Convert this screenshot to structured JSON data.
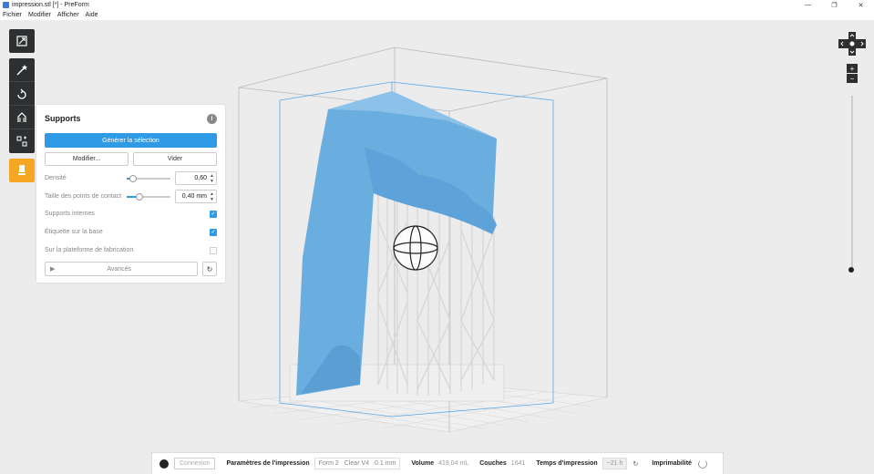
{
  "window": {
    "title": "impression.stl [*] - PreForm",
    "minimize": "—",
    "maximize": "❐",
    "close": "✕"
  },
  "menu": [
    "Fichier",
    "Modifier",
    "Afficher",
    "Aide"
  ],
  "toolbar": {
    "icons": [
      "layout-icon",
      "magic-wand-icon",
      "rotate-icon",
      "supports-icon",
      "layout-tools-icon",
      "print-icon"
    ],
    "active_color": "#f5a623",
    "dark_color": "#2d2f31"
  },
  "supports_panel": {
    "title": "Supports",
    "info": "i",
    "generate_label": "Générer la sélection",
    "modify_label": "Modifier...",
    "clear_label": "Vider",
    "density": {
      "label": "Densité",
      "value": "0,60",
      "slider_fraction": 0.15
    },
    "contact_size": {
      "label": "Taille des points de contact",
      "value": "0,40 mm",
      "slider_fraction": 0.3
    },
    "options": [
      {
        "label": "Supports internes",
        "checked": true
      },
      {
        "label": "Étiquette sur la base",
        "checked": true
      },
      {
        "label": "Sur la plateforme de fabrication",
        "checked": false
      }
    ],
    "advanced_label": "Avancés",
    "reset": "↻"
  },
  "zoom": {
    "plus": "+",
    "minus": "−"
  },
  "statusbar": {
    "login_label": "Connexion",
    "print_params_label": "Paramètres de l'impression",
    "printer": "Form 2",
    "resin": "Clear V4",
    "layer_thickness": "0.1 mm",
    "volume_label": "Volume",
    "volume_value": "419,04 mL",
    "layers_label": "Couches",
    "layers_value": "1641",
    "print_time_label": "Temps d'impression",
    "print_time_value": "~21 h",
    "printability_label": "Imprimabilité"
  },
  "colors": {
    "accent": "#2f9be6",
    "model": "#6aaee0",
    "supports": "#f2f2f2"
  }
}
